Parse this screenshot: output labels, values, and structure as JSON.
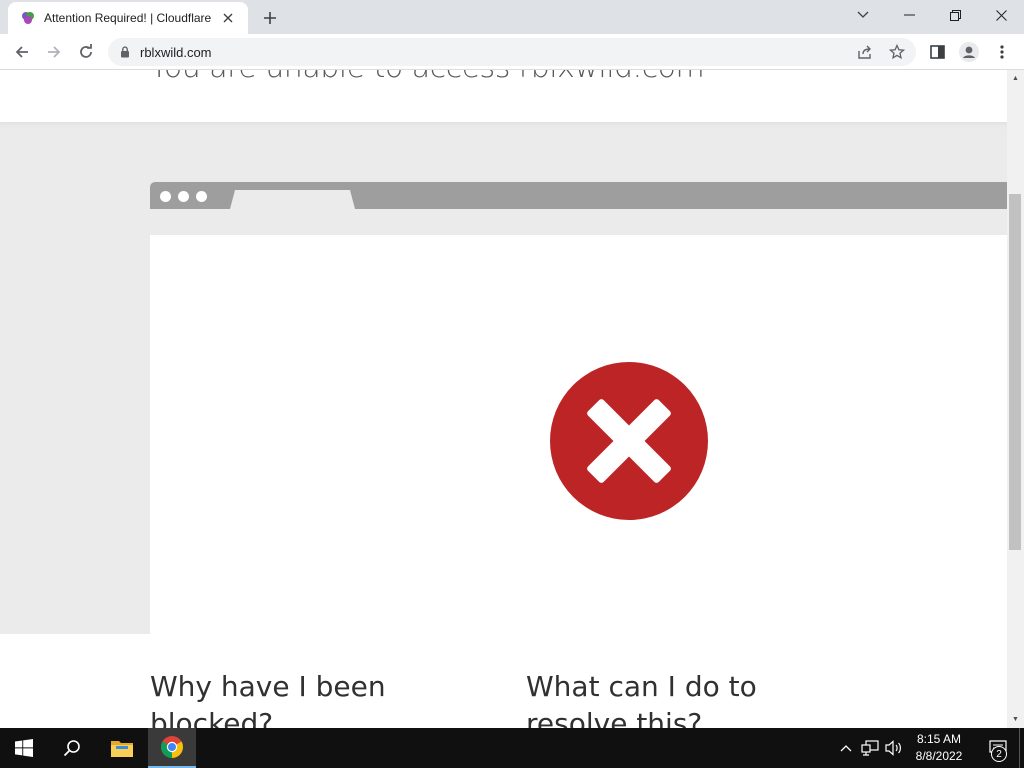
{
  "browser": {
    "tab_title": "Attention Required! | Cloudflare",
    "url": "rblxwild.com"
  },
  "page": {
    "heading": "You are unable to access rblxwild.com",
    "why_heading": "Why have I been blocked?",
    "resolve_heading": "What can I do to resolve this?",
    "error_color": "#bd2426"
  },
  "taskbar": {
    "time": "8:15 AM",
    "date": "8/8/2022",
    "notification_count": "2",
    "pinned": [
      "start-icon",
      "search-icon",
      "file-explorer-icon",
      "chrome-icon"
    ]
  }
}
